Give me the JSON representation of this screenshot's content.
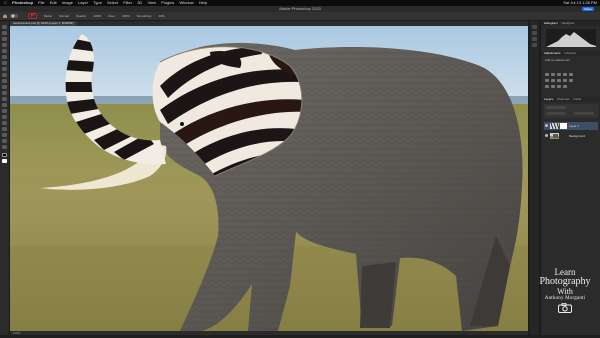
{
  "menubar": {
    "app": "Photoshop",
    "items": [
      "File",
      "Edit",
      "Image",
      "Layer",
      "Type",
      "Select",
      "Filter",
      "3D",
      "View",
      "Plugins",
      "Window",
      "Help"
    ],
    "clock": "Sat Jul 13 1:26 PM"
  },
  "app_header": {
    "title": "Adobe Photoshop 2023",
    "share_label": "Share"
  },
  "options_bar": {
    "items": [
      "Mode:",
      "Normal",
      "Opacity:",
      "100%",
      "Flow:",
      "100%",
      "Smoothing:",
      "10%"
    ]
  },
  "document_tab": {
    "label": "elephant-doc.psd @ 100% (Layer 1, RGB/8#)"
  },
  "status_bar": {
    "zoom": "100%"
  },
  "panels": {
    "histogram_tabs": [
      "Histogram",
      "Navigator"
    ],
    "adjustments_tabs": [
      "Adjustments",
      "Libraries"
    ],
    "adjustments_label": "Add an adjustment",
    "layers_tabs": [
      "Layers",
      "Channels",
      "Paths"
    ],
    "layers": [
      {
        "name": "Layer 1",
        "selected": true
      },
      {
        "name": "Background",
        "selected": false
      }
    ]
  },
  "watermark": {
    "line1": "Learn",
    "line2": "Photography",
    "line3": "With",
    "line4": "Anthony Morganti"
  },
  "colors": {
    "accent": "#1473e6",
    "ps_logo": "#c0242a",
    "sky": "#b9d2e6",
    "grass": "#9a8e55"
  }
}
